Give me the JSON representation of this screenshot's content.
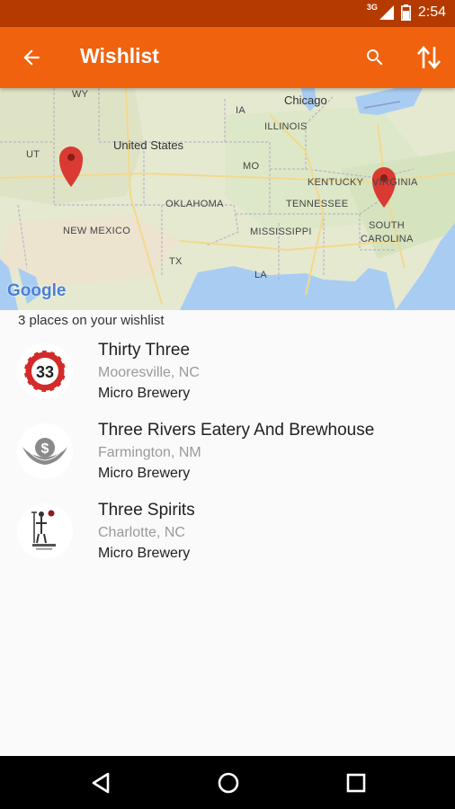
{
  "status_bar": {
    "network": "3G",
    "time": "2:54"
  },
  "app_bar": {
    "title": "Wishlist",
    "icons": [
      "arrow-back-icon",
      "search-icon",
      "sort-icon"
    ]
  },
  "map": {
    "labels": {
      "wy": "WY",
      "ia": "IA",
      "chicago": "Chicago",
      "illinois": "ILLINOIS",
      "ut": "UT",
      "united_states": "United States",
      "mo": "MO",
      "kentucky": "KENTUCKY",
      "virginia": "VIRGINIA",
      "oklahoma": "OKLAHOMA",
      "tennessee": "TENNESSEE",
      "new_mexico": "NEW MEXICO",
      "mississippi": "MISSISSIPPI",
      "south_carolina_1": "SOUTH",
      "south_carolina_2": "CAROLINA",
      "tx": "TX",
      "la": "LA"
    },
    "google_logo": "Google"
  },
  "wishlist": {
    "count_label": "3 places on your wishlist",
    "items": [
      {
        "name": "Thirty Three",
        "location": "Mooresville, NC",
        "type": "Micro Brewery",
        "badge": "33"
      },
      {
        "name": "Three Rivers Eatery And Brewhouse",
        "location": "Farmington, NM",
        "type": "Micro Brewery"
      },
      {
        "name": "Three Spirits",
        "location": "Charlotte, NC",
        "type": "Micro Brewery"
      }
    ]
  },
  "colors": {
    "app_bar": "#f0620e",
    "status_bar": "#b53a00",
    "marker": "#d93a32"
  }
}
